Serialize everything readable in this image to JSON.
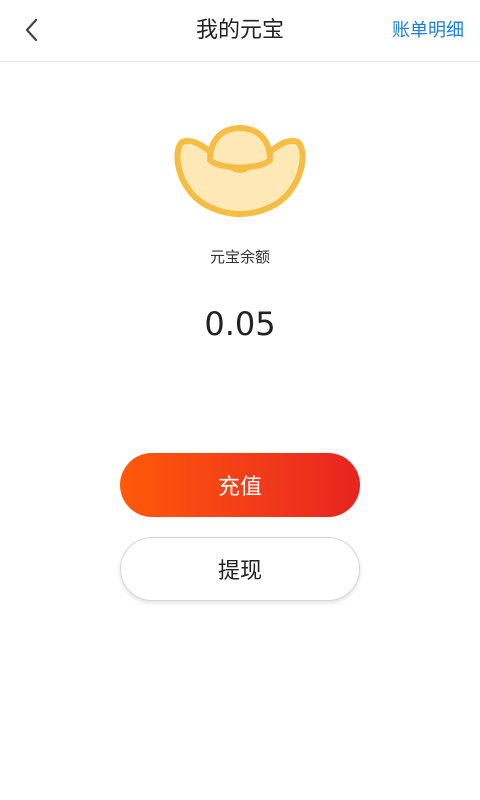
{
  "header": {
    "back_icon": "chevron-left-icon",
    "title": "我的元宝",
    "bill_link": "账单明细"
  },
  "balance": {
    "icon": "gold-ingot-icon",
    "label": "元宝余额",
    "value": "0.05"
  },
  "actions": {
    "recharge_label": "充值",
    "withdraw_label": "提现"
  },
  "colors": {
    "accent": "#1a7fe0",
    "ingot_stroke": "#f6bd44",
    "ingot_fill": "#fde8b6",
    "recharge_gradient_start": "#ff5a0a",
    "recharge_gradient_end": "#e8231f"
  }
}
